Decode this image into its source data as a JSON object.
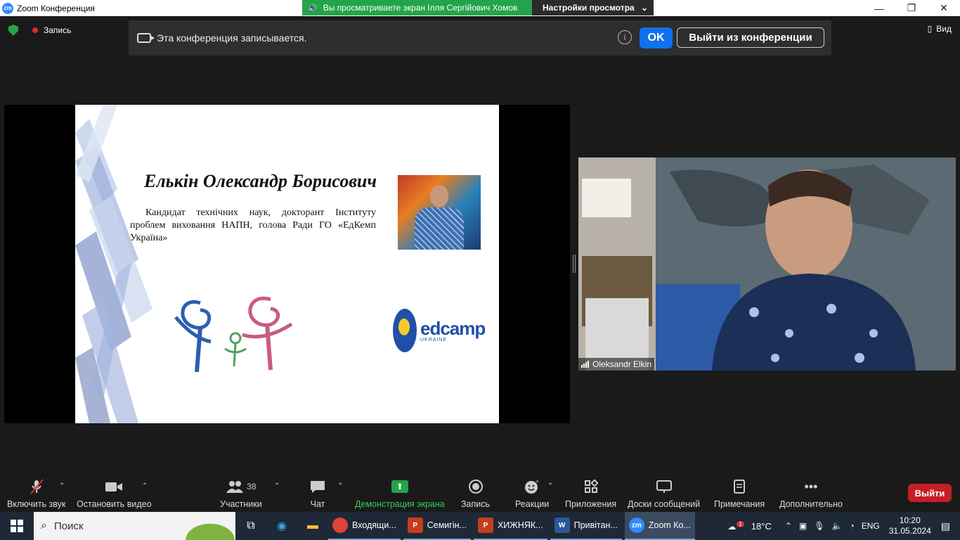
{
  "window": {
    "app_icon": "zm",
    "title": "Zoom Конференция",
    "share_banner": "Вы просматриваете экран Ілля Сергійович Хомов",
    "view_settings": "Настройки просмотра"
  },
  "topbar": {
    "record_label": "Запись",
    "view_label": "Вид"
  },
  "notice": {
    "text": "Эта конференция записывается.",
    "info": "i",
    "ok_label": "OK",
    "leave_label": "Выйти из конференции"
  },
  "slide": {
    "title": "Елькін Олександр Борисович",
    "description": "Кандидат технічних наук, докторант Інституту проблем виховання НАПН, голова Ради ГО «ЕдКемп Україна»",
    "logo_word": "edcamp",
    "logo_sub": "UKRAINE"
  },
  "video": {
    "participant_name": "Oleksandr Elkin"
  },
  "toolbar": {
    "mute_label": "Включить звук",
    "video_label": "Остановить видео",
    "participants_label": "Участники",
    "participants_count": "38",
    "chat_label": "Чат",
    "share_label": "Демонстрация экрана",
    "record_label": "Запись",
    "reactions_label": "Реакции",
    "apps_label": "Приложения",
    "whiteboards_label": "Доски сообщений",
    "notes_label": "Примечания",
    "more_label": "Дополнительно",
    "exit_label": "Выйти"
  },
  "taskbar": {
    "search_placeholder": "Поиск",
    "apps": [
      {
        "label": "Входящи...",
        "icon": "chrome-icon",
        "color": "#db4437"
      },
      {
        "label": "Семигін...",
        "icon": "powerpoint-icon",
        "color": "#c43e1c"
      },
      {
        "label": "ХИЖНЯК...",
        "icon": "powerpoint-icon",
        "color": "#c43e1c"
      },
      {
        "label": "Привітан...",
        "icon": "word-icon",
        "color": "#2b579a"
      },
      {
        "label": "Zoom Ко...",
        "icon": "zoom-icon",
        "color": "#2d8cff"
      }
    ],
    "weather_badge": "1",
    "temperature": "18°C",
    "language": "ENG",
    "time": "10:20",
    "date": "31.05.2024"
  }
}
